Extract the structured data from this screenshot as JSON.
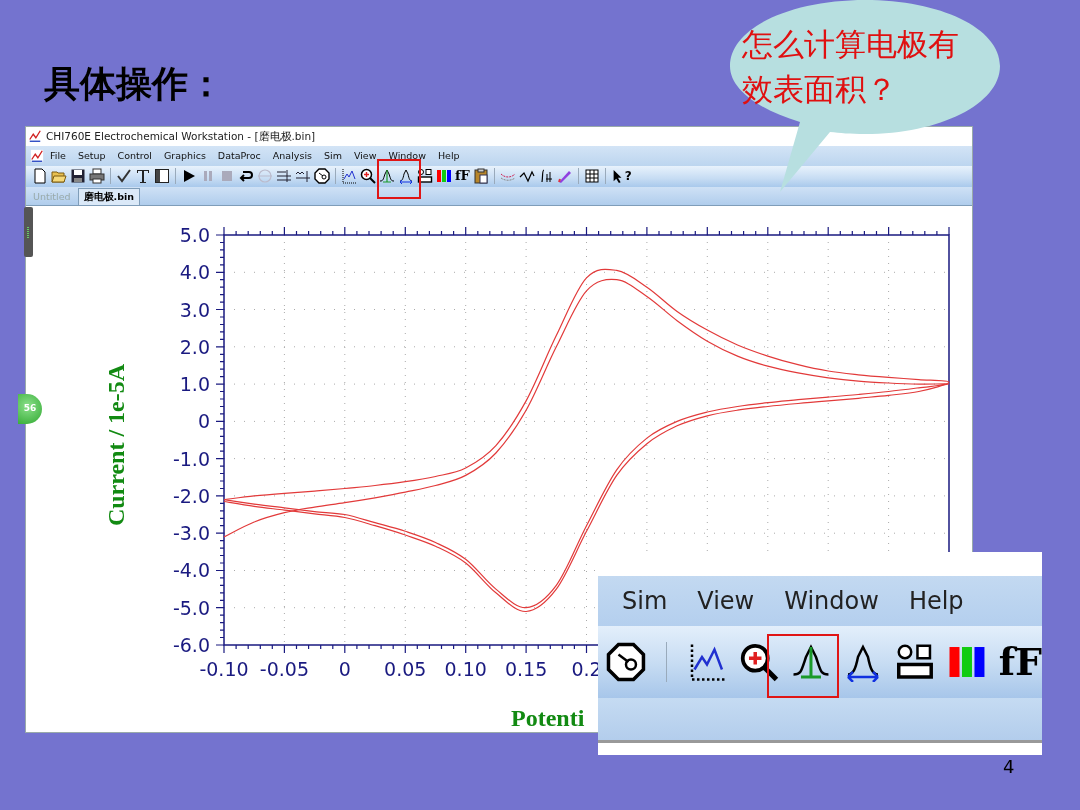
{
  "slide": {
    "title": "具体操作：",
    "callout": "怎么计算电极有效表面积？",
    "page_number": "4"
  },
  "window": {
    "title": "CHI760E Electrochemical Workstation - [磨电极.bin]",
    "menu": [
      "File",
      "Setup",
      "Control",
      "Graphics",
      "DataProc",
      "Analysis",
      "Sim",
      "View",
      "Window",
      "Help"
    ],
    "toolbar_glyphs": {
      "font": "fF",
      "help": "?"
    },
    "tabs": [
      {
        "label": "Untitled",
        "selected": false
      },
      {
        "label": "磨电极.bin",
        "selected": true
      }
    ],
    "badge": "56",
    "plot": {
      "chart_data": {
        "type": "line",
        "xlabel": "Potenti",
        "ylabel": "Current / 1e-5A",
        "series": [
          {
            "color": "#e23a3a",
            "x": [
              -0.1,
              -0.075,
              -0.05,
              -0.025,
              0,
              0.025,
              0.05,
              0.075,
              0.1,
              0.125,
              0.15,
              0.175,
              0.2,
              0.225,
              0.25,
              0.275,
              0.3,
              0.325,
              0.35,
              0.375,
              0.4,
              0.425,
              0.45,
              0.475,
              0.5,
              0.475,
              0.45,
              0.425,
              0.4,
              0.375,
              0.35,
              0.325,
              0.3,
              0.275,
              0.25,
              0.225,
              0.2,
              0.175,
              0.15,
              0.125,
              0.1,
              0.075,
              0.05,
              0.025,
              0,
              -0.025,
              -0.05,
              -0.075,
              -0.1
            ],
            "values": [
              -3.1,
              -2.7,
              -2.45,
              -2.3,
              -2.18,
              -2.05,
              -1.9,
              -1.72,
              -1.45,
              -0.85,
              0.3,
              2.0,
              3.5,
              3.8,
              3.35,
              2.7,
              2.15,
              1.75,
              1.48,
              1.3,
              1.17,
              1.08,
              1.03,
              1.0,
              1.0,
              0.9,
              0.8,
              0.72,
              0.65,
              0.58,
              0.5,
              0.4,
              0.25,
              0.0,
              -0.45,
              -1.3,
              -2.8,
              -4.4,
              -5.0,
              -4.5,
              -3.7,
              -3.25,
              -2.95,
              -2.72,
              -2.5,
              -2.42,
              -2.32,
              -2.22,
              -2.1
            ]
          },
          {
            "color": "#e23a3a",
            "x": [
              -0.1,
              -0.075,
              -0.05,
              -0.025,
              0,
              0.025,
              0.05,
              0.075,
              0.1,
              0.125,
              0.15,
              0.175,
              0.2,
              0.225,
              0.25,
              0.275,
              0.3,
              0.325,
              0.35,
              0.375,
              0.4,
              0.425,
              0.45,
              0.475,
              0.5,
              0.475,
              0.45,
              0.425,
              0.4,
              0.375,
              0.35,
              0.325,
              0.3,
              0.275,
              0.25,
              0.225,
              0.2,
              0.175,
              0.15,
              0.125,
              0.1,
              0.075,
              0.05,
              0.025,
              0,
              -0.025,
              -0.05,
              -0.075,
              -0.1
            ],
            "values": [
              -2.1,
              -2.0,
              -1.93,
              -1.87,
              -1.8,
              -1.72,
              -1.62,
              -1.48,
              -1.25,
              -0.65,
              0.55,
              2.3,
              3.85,
              4.05,
              3.6,
              2.95,
              2.45,
              2.05,
              1.75,
              1.52,
              1.35,
              1.25,
              1.18,
              1.12,
              1.05,
              0.8,
              0.7,
              0.62,
              0.55,
              0.48,
              0.4,
              0.3,
              0.15,
              -0.12,
              -0.6,
              -1.45,
              -2.95,
              -4.5,
              -5.1,
              -4.6,
              -3.8,
              -3.35,
              -3.05,
              -2.8,
              -2.58,
              -2.48,
              -2.38,
              -2.28,
              -2.15
            ]
          }
        ],
        "xlim": [
          -0.1,
          0.5
        ],
        "ylim": [
          -6,
          5
        ],
        "grid": true,
        "xticks": [
          {
            "value": -0.1,
            "label": "-0.10"
          },
          {
            "value": -0.05,
            "label": "-0.05"
          },
          {
            "value": 0,
            "label": "0"
          },
          {
            "value": 0.05,
            "label": "0.05"
          },
          {
            "value": 0.1,
            "label": "0.10"
          },
          {
            "value": 0.15,
            "label": "0.15"
          },
          {
            "value": 0.2,
            "label": "0.2"
          }
        ],
        "yticks": [
          {
            "value": 5,
            "label": "5.0"
          },
          {
            "value": 4,
            "label": "4.0"
          },
          {
            "value": 3,
            "label": "3.0"
          },
          {
            "value": 2,
            "label": "2.0"
          },
          {
            "value": 1,
            "label": "1.0"
          },
          {
            "value": 0,
            "label": "0"
          },
          {
            "value": -1,
            "label": "-1.0"
          },
          {
            "value": -2,
            "label": "-2.0"
          },
          {
            "value": -3,
            "label": "-3.0"
          },
          {
            "value": -4,
            "label": "-4.0"
          },
          {
            "value": -5,
            "label": "-5.0"
          },
          {
            "value": -6,
            "label": "-6.0"
          }
        ]
      }
    }
  },
  "inset": {
    "menu": [
      "Sim",
      "View",
      "Window",
      "Help"
    ],
    "toolbar_glyphs": {
      "font": "fF"
    }
  }
}
